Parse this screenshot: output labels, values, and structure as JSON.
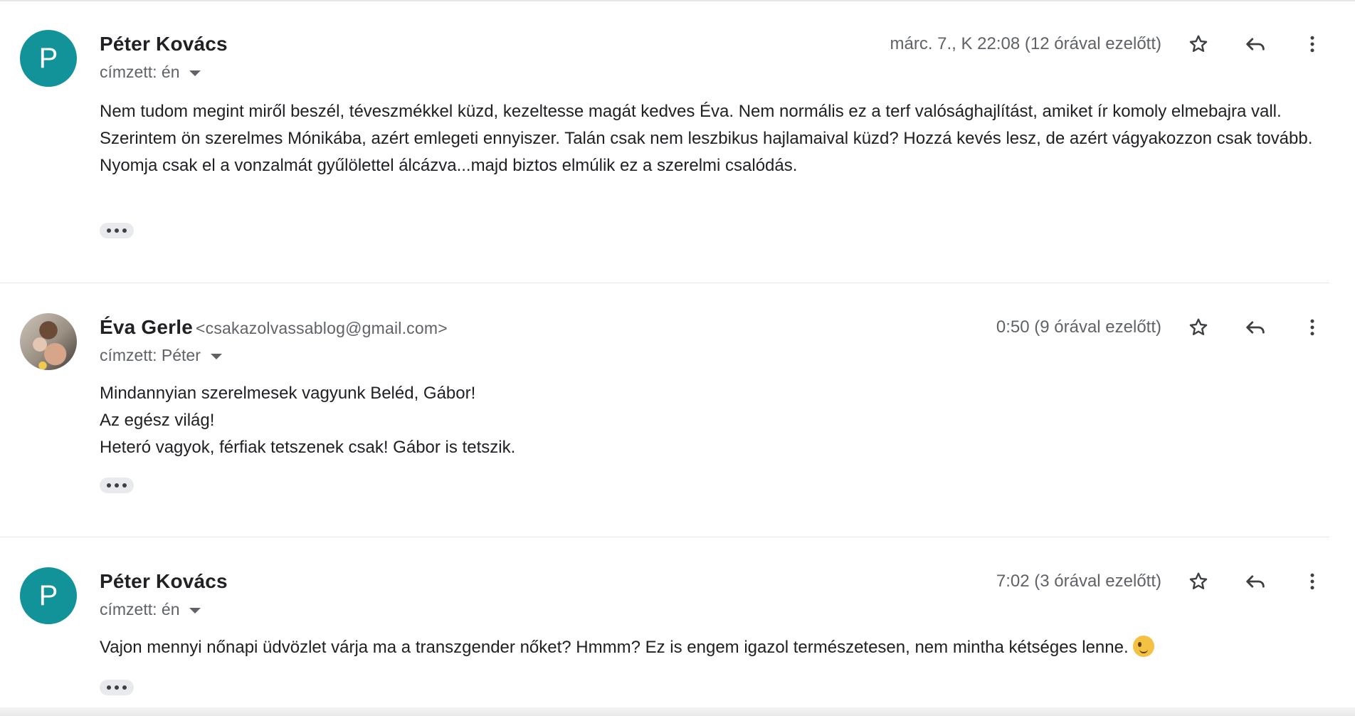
{
  "messages": [
    {
      "avatar_letter": "P",
      "sender": "Péter Kovács",
      "email": "",
      "recipient": "címzett: én",
      "date": "márc. 7., K 22:08 (12 órával ezelőtt)",
      "body": [
        "Nem tudom megint miről beszél, téveszmékkel küzd, kezeltesse magát kedves Éva. Nem normális ez a terf valósághajlítást, amiket ír komoly elmebajra vall.",
        "Szerintem ön szerelmes Mónikába, azért emlegeti ennyiszer. Talán csak nem leszbikus hajlamaival küzd? Hozzá kevés lesz, de azért vágyakozzon csak tovább. Nyomja csak el a vonzalmát gyűlölettel álcázva...majd biztos elmúlik ez a szerelmi csalódás."
      ]
    },
    {
      "avatar_letter": "",
      "sender": "Éva Gerle",
      "email": "<csakazolvassablog@gmail.com>",
      "recipient": "címzett: Péter",
      "date": "0:50 (9 órával ezelőtt)",
      "body": [
        "Mindannyian szerelmesek vagyunk Beléd, Gábor!",
        "Az egész világ!",
        "Heteró vagyok, férfiak tetszenek csak! Gábor is tetszik."
      ]
    },
    {
      "avatar_letter": "P",
      "sender": "Péter Kovács",
      "email": "",
      "recipient": "címzett: én",
      "date": "7:02 (3 órával ezelőtt)",
      "body": [
        "Vajon mennyi nőnapi üdvözlet várja ma a transzgender nőket? Hmmm? Ez is engem igazol természetesen, nem mintha kétséges lenne."
      ]
    }
  ],
  "icons": {
    "star": "star-icon",
    "reply": "reply-icon",
    "more": "more-vert-icon",
    "expand": "more-horiz-icon",
    "emoji": "winking-face-emoji"
  },
  "colors": {
    "avatar_bg": "#12939a",
    "muted_text": "#5f6368"
  }
}
